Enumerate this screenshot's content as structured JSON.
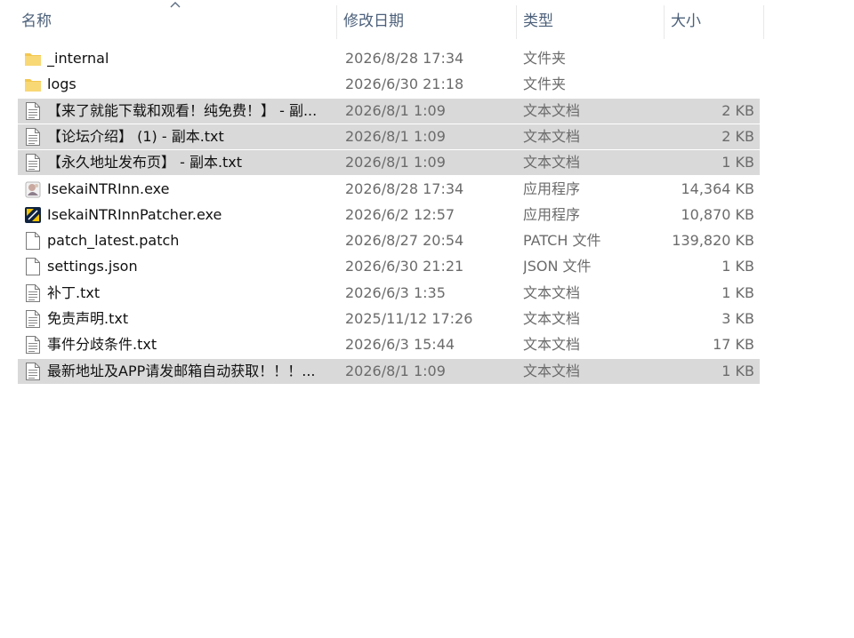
{
  "columns": {
    "name": "名称",
    "date": "修改日期",
    "type": "类型",
    "size": "大小"
  },
  "files": [
    {
      "icon": "folder-icon",
      "name": "_internal",
      "date": "2026/8/28 17:34",
      "type": "文件夹",
      "size": "",
      "selected": false
    },
    {
      "icon": "folder-icon",
      "name": "logs",
      "date": "2026/6/30 21:18",
      "type": "文件夹",
      "size": "",
      "selected": false
    },
    {
      "icon": "text-document-icon",
      "name": "【来了就能下载和观看！纯免费！】 - 副...",
      "date": "2026/8/1 1:09",
      "type": "文本文档",
      "size": "2 KB",
      "selected": true
    },
    {
      "icon": "text-document-icon",
      "name": "【论坛介绍】 (1) - 副本.txt",
      "date": "2026/8/1 1:09",
      "type": "文本文档",
      "size": "2 KB",
      "selected": true
    },
    {
      "icon": "text-document-icon",
      "name": "【永久地址发布页】 - 副本.txt",
      "date": "2026/8/1 1:09",
      "type": "文本文档",
      "size": "1 KB",
      "selected": true
    },
    {
      "icon": "app-exe-icon",
      "name": "IsekaiNTRInn.exe",
      "date": "2026/8/28 17:34",
      "type": "应用程序",
      "size": "14,364 KB",
      "selected": false
    },
    {
      "icon": "patcher-exe-icon",
      "name": "IsekaiNTRInnPatcher.exe",
      "date": "2026/6/2 12:57",
      "type": "应用程序",
      "size": "10,870 KB",
      "selected": false
    },
    {
      "icon": "blank-file-icon",
      "name": "patch_latest.patch",
      "date": "2026/8/27 20:54",
      "type": "PATCH 文件",
      "size": "139,820 KB",
      "selected": false
    },
    {
      "icon": "blank-file-icon",
      "name": "settings.json",
      "date": "2026/6/30 21:21",
      "type": "JSON 文件",
      "size": "1 KB",
      "selected": false
    },
    {
      "icon": "text-document-icon",
      "name": "补丁.txt",
      "date": "2026/6/3 1:35",
      "type": "文本文档",
      "size": "1 KB",
      "selected": false
    },
    {
      "icon": "text-document-icon",
      "name": "免责声明.txt",
      "date": "2025/11/12 17:26",
      "type": "文本文档",
      "size": "3 KB",
      "selected": false
    },
    {
      "icon": "text-document-icon",
      "name": "事件分歧条件.txt",
      "date": "2026/6/3 15:44",
      "type": "文本文档",
      "size": "17 KB",
      "selected": false
    },
    {
      "icon": "text-document-icon",
      "name": "最新地址及APP请发邮箱自动获取！！！...",
      "date": "2026/8/1 1:09",
      "type": "文本文档",
      "size": "1 KB",
      "selected": true
    }
  ],
  "colors": {
    "selected_row": "#d9d9d9",
    "folder": "#f8d775",
    "header_text": "#4c607a"
  }
}
